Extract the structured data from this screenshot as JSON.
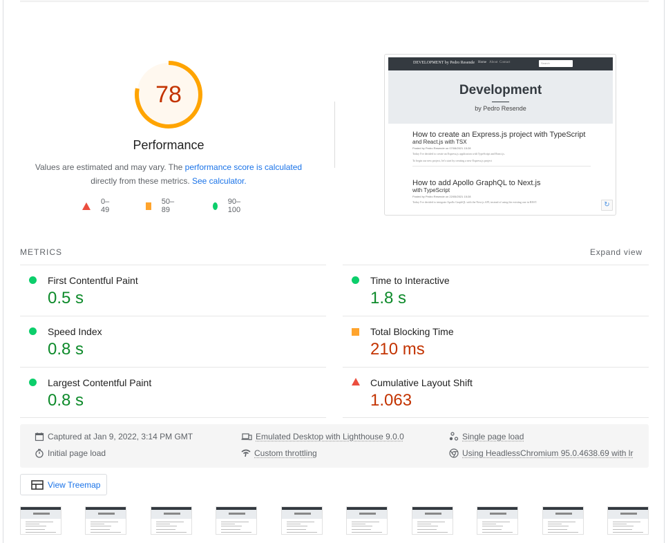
{
  "gauge": {
    "score": "78",
    "score_fraction": 0.78,
    "label": "Performance",
    "color": "#ffa400",
    "bg_color": "#fff8ef",
    "text_color": "#c33300"
  },
  "description": {
    "text_before": "Values are estimated and may vary. The ",
    "link1": "performance score is calculated",
    "text_middle": "directly from these metrics.",
    "link2": "See calculator."
  },
  "legend": [
    {
      "shape": "triangle",
      "range": "0–49",
      "color": "#eb4e3e"
    },
    {
      "shape": "square",
      "range": "50–89",
      "color": "#ffa42d"
    },
    {
      "shape": "circle",
      "range": "90–100",
      "color": "#0cce6b"
    }
  ],
  "preview": {
    "nav_brand": "DEVELOPMENT by Pedro Resende",
    "nav_links": [
      "Home",
      "About",
      "Contact"
    ],
    "search_placeholder": "Search",
    "hero_title": "Development",
    "hero_subtitle": "by Pedro Resende",
    "posts": [
      {
        "title": "How to create an Express.js project with TypeScript",
        "subtitle": "and React.js with TSX",
        "meta": "Posted by Pedro Resende on 07/08/2021 15:28",
        "lines": [
          "Today I've decided to create an Express.js application with TypeScript and React.js.",
          "To begin our new project, let's start by creating a new Express.js project"
        ]
      },
      {
        "title": "How to add Apollo GraphQL to Next.js",
        "subtitle": "with TypeScript",
        "meta": "Posted by Pedro Resende on 22/05/2021 15:28",
        "lines": [
          "Today I've decided to integrate Apollo GraphQL with the Next.js API, instead of using the existing one in REST."
        ]
      }
    ]
  },
  "metrics": {
    "title": "METRICS",
    "expand_label": "Expand view",
    "items": [
      {
        "name": "First Contentful Paint",
        "value": "0.5 s",
        "rating": "good"
      },
      {
        "name": "Time to Interactive",
        "value": "1.8 s",
        "rating": "good"
      },
      {
        "name": "Speed Index",
        "value": "0.8 s",
        "rating": "good"
      },
      {
        "name": "Total Blocking Time",
        "value": "210 ms",
        "rating": "average"
      },
      {
        "name": "Largest Contentful Paint",
        "value": "0.8 s",
        "rating": "good"
      },
      {
        "name": "Cumulative Layout Shift",
        "value": "1.063",
        "rating": "poor"
      }
    ]
  },
  "runtime": {
    "captured": "Captured at Jan 9, 2022, 3:14 PM GMT",
    "initial_load": "Initial page load",
    "emulated": "Emulated Desktop with Lighthouse 9.0.0",
    "throttling": "Custom throttling",
    "single_load": "Single page load",
    "browser": "Using HeadlessChromium 95.0.4638.69 with lr"
  },
  "treemap_label": "View Treemap",
  "filmstrip_count": 10
}
